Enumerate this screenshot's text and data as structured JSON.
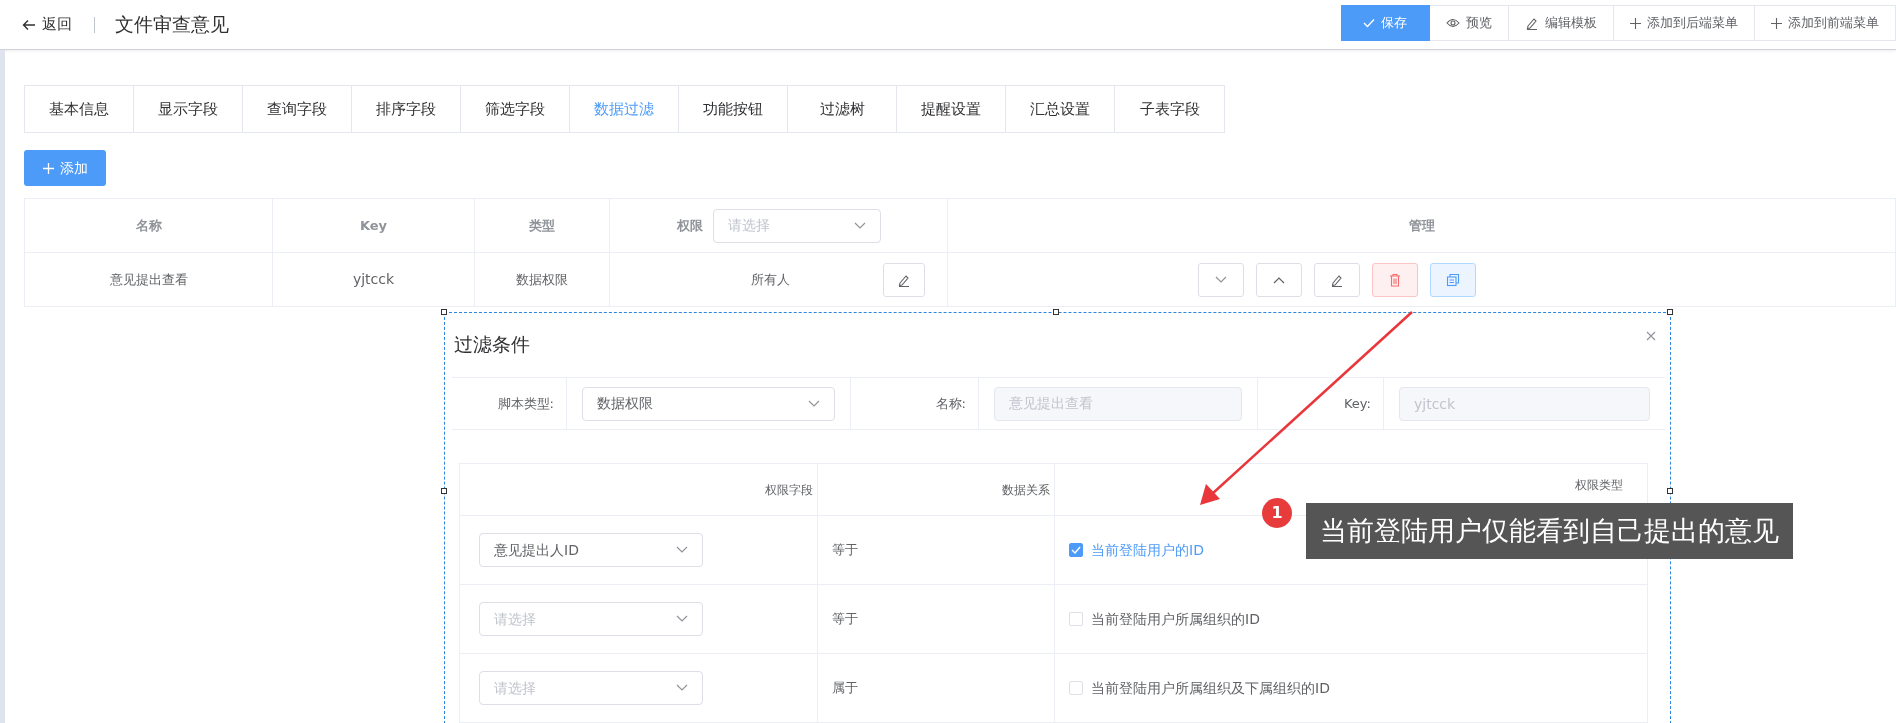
{
  "header": {
    "back": "返回",
    "title": "文件审查意见",
    "actions": [
      {
        "label": "保存",
        "kind": "primary"
      },
      {
        "label": "预览",
        "kind": "plain"
      },
      {
        "label": "编辑模板",
        "kind": "plain"
      },
      {
        "label": "添加到后端菜单",
        "kind": "plain"
      },
      {
        "label": "添加到前端菜单",
        "kind": "plain"
      }
    ]
  },
  "tabs": [
    {
      "label": "基本信息",
      "selected": false
    },
    {
      "label": "显示字段",
      "selected": false
    },
    {
      "label": "查询字段",
      "selected": false
    },
    {
      "label": "排序字段",
      "selected": false
    },
    {
      "label": "筛选字段",
      "selected": false
    },
    {
      "label": "数据过滤",
      "selected": true
    },
    {
      "label": "功能按钮",
      "selected": false
    },
    {
      "label": "过滤树",
      "selected": false
    },
    {
      "label": "提醒设置",
      "selected": false
    },
    {
      "label": "汇总设置",
      "selected": false
    },
    {
      "label": "子表字段",
      "selected": false
    }
  ],
  "add_button": "添加",
  "table": {
    "columns": [
      "名称",
      "Key",
      "类型",
      "权限",
      "管理"
    ],
    "permission_placeholder": "请选择",
    "rows": [
      {
        "name": "意见提出查看",
        "key": "yjtcck",
        "type": "数据权限",
        "permission": "所有人"
      }
    ]
  },
  "dialog": {
    "title": "过滤条件",
    "script_type_label": "脚本类型:",
    "script_type": "数据权限",
    "name_label": "名称:",
    "name_value": "意见提出查看",
    "key_label": "Key:",
    "key_value": "yjtcck",
    "columns": [
      "权限字段",
      "数据关系",
      "权限类型"
    ],
    "rows": [
      {
        "field": {
          "value": "意见提出人ID"
        },
        "relation": "等于",
        "option": "当前登陆用户的ID",
        "checked": true
      },
      {
        "field": {
          "placeholder": "请选择"
        },
        "relation": "等于",
        "option": "当前登陆用户所属组织的ID",
        "checked": false
      },
      {
        "field": {
          "placeholder": "请选择"
        },
        "relation": "属于",
        "option": "当前登陆用户所属组织及下属组织的ID",
        "checked": false
      }
    ]
  },
  "annotation": {
    "number": "1",
    "text": "当前登陆用户仅能看到自己提出的意见"
  }
}
